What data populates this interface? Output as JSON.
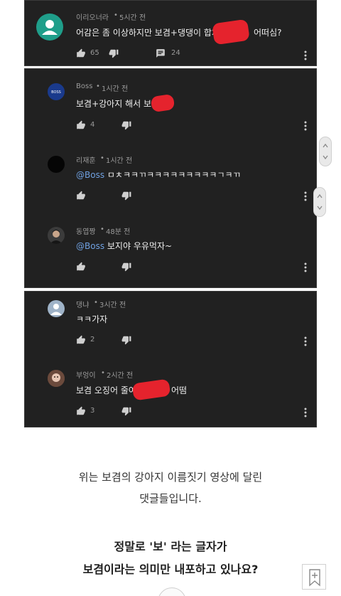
{
  "comments": [
    {
      "author": "이리오너라",
      "time": "5시간 전",
      "text_before": "어감은 좀 이상하지만 보겸+댕댕이 합쳐",
      "text_after": "어떠심?",
      "likes": "65",
      "replies": "24"
    },
    {
      "author": "Boss",
      "time": "1시간 전",
      "text": "보겸+강아지 해서 보",
      "likes": "4",
      "avatar_text": "BOSS"
    },
    {
      "author": "리재훈",
      "time": "1시간 전",
      "mention": "@Boss",
      "text": " ㅁㅊㅋㅋㄲㅋㅋㅋㅋㅋㅋㅋㅋㅋㄱㅋㄲ"
    },
    {
      "author": "동엽짱",
      "time": "48분 전",
      "mention": "@Boss",
      "text": " 보지야 우유먹자~"
    },
    {
      "author": "댕냐",
      "time": "3시간 전",
      "text": "ㅋㅋ가자",
      "likes": "2"
    },
    {
      "author": "부엉이",
      "time": "2시간 전",
      "text_before": "보겸 오징어 줄여서",
      "text_after": "어떰",
      "likes": "3"
    }
  ],
  "caption": {
    "line1": "위는 보겸의 강아지 이름짓기 영상에 달린",
    "line2": "댓글들입니다."
  },
  "headline": {
    "line1": "정말로 '보' 라는 글자가",
    "line2": "보겸이라는 의미만 내포하고 있나요?"
  },
  "colors": {
    "panel_bg": "#212121",
    "redaction": "#e5232d",
    "mention": "#6fa0e0"
  },
  "icons": [
    "thumbs-up-icon",
    "thumbs-down-icon",
    "reply-icon",
    "more-vert-icon",
    "bookmark-icon"
  ]
}
